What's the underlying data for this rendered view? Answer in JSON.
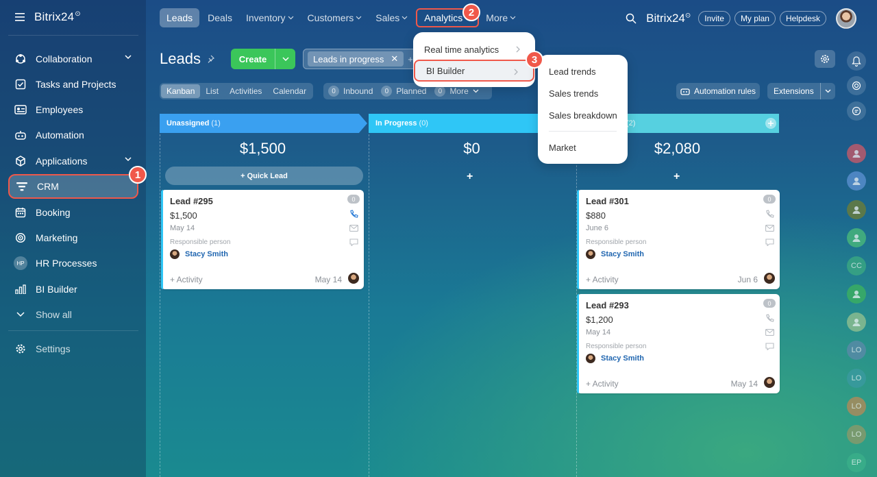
{
  "app": {
    "logo": "Bitrix24",
    "logo_mark": "⊙"
  },
  "sidebar": {
    "items": [
      {
        "label": "Collaboration",
        "icon": "collaboration-icon",
        "expand": true
      },
      {
        "label": "Tasks and Projects",
        "icon": "tasks-icon"
      },
      {
        "label": "Employees",
        "icon": "employees-icon"
      },
      {
        "label": "Automation",
        "icon": "automation-icon"
      },
      {
        "label": "Applications",
        "icon": "applications-icon",
        "expand": true
      },
      {
        "label": "CRM",
        "icon": "crm-icon",
        "active": true
      },
      {
        "label": "Booking",
        "icon": "booking-icon"
      },
      {
        "label": "Marketing",
        "icon": "marketing-icon"
      },
      {
        "label": "HR Processes",
        "icon": "hr-icon",
        "badge": "HP"
      },
      {
        "label": "BI Builder",
        "icon": "bi-builder-icon"
      },
      {
        "label": "Show all",
        "icon": "chevron-down-icon"
      }
    ],
    "settings": "Settings"
  },
  "topnav": [
    {
      "label": "Leads",
      "active": true
    },
    {
      "label": "Deals"
    },
    {
      "label": "Inventory",
      "dropdown": true
    },
    {
      "label": "Customers",
      "dropdown": true
    },
    {
      "label": "Sales",
      "dropdown": true
    },
    {
      "label": "Analytics",
      "dropdown": true,
      "highlight": true
    },
    {
      "label": "More",
      "dropdown": true
    }
  ],
  "header_right": {
    "logo": "Bitrix24",
    "invite": "Invite",
    "my_plan": "My plan",
    "helpdesk": "Helpdesk"
  },
  "page": {
    "title": "Leads",
    "create": "Create",
    "filter_chip": "Leads in progress",
    "filter_plus": "+"
  },
  "views": [
    "Kanban",
    "List",
    "Activities",
    "Calendar"
  ],
  "counters": [
    {
      "n": "0",
      "label": "Inbound"
    },
    {
      "n": "0",
      "label": "Planned"
    },
    {
      "n": "0",
      "label": "More"
    }
  ],
  "automation_rules": "Automation rules",
  "extensions": "Extensions",
  "columns": [
    {
      "name": "Unassigned",
      "count": "(1)",
      "sum": "$1,500",
      "color": "#3aa0f0",
      "quick_lead": "+ Quick Lead"
    },
    {
      "name": "In Progress",
      "count": "(0)",
      "sum": "$0",
      "color": "#2fc6f6"
    },
    {
      "name": "",
      "count": "(2)",
      "sum": "$2,080",
      "color": "#56d0e0"
    }
  ],
  "cards": [
    {
      "title": "Lead #295",
      "amount": "$1,500",
      "date": "May 14",
      "resp_label": "Responsible person",
      "person": "Stacy Smith",
      "activity": "+ Activity",
      "act_date": "May 14",
      "badge": "0",
      "phone_active": true
    },
    {
      "title": "Lead #301",
      "amount": "$880",
      "date": "June 6",
      "resp_label": "Responsible person",
      "person": "Stacy Smith",
      "activity": "+ Activity",
      "act_date": "Jun 6",
      "badge": "0"
    },
    {
      "title": "Lead #293",
      "amount": "$1,200",
      "date": "May 14",
      "resp_label": "Responsible person",
      "person": "Stacy Smith",
      "activity": "+ Activity",
      "act_date": "May 14",
      "badge": "0"
    }
  ],
  "analytics_menu": {
    "items": [
      "Real time analytics",
      "BI Builder"
    ]
  },
  "bi_submenu": {
    "items": [
      "Lead trends",
      "Sales trends",
      "Sales breakdown",
      "Market"
    ]
  },
  "callouts": [
    "1",
    "2",
    "3"
  ],
  "right_rail": [
    {
      "icon": "bell-icon"
    },
    {
      "icon": "copilot-icon"
    },
    {
      "icon": "chat-icon"
    },
    {
      "icon": "group-avatar-icon",
      "color": "#c45a6a"
    },
    {
      "icon": "group-avatar-icon",
      "color": "#5a8fcf"
    },
    {
      "icon": "user-avatar-icon",
      "color": "#6b7d3a"
    },
    {
      "icon": "chat-bubble-icon",
      "color": "#49b87a"
    },
    {
      "text": "CC",
      "color": "#3aa882"
    },
    {
      "icon": "notes-icon",
      "color": "#3bb060"
    },
    {
      "icon": "chart-icon",
      "color": "#8fbf90"
    },
    {
      "text": "LO",
      "color": "#5a8aa8"
    },
    {
      "text": "LO",
      "color": "#3a9aa0"
    },
    {
      "text": "LO",
      "color": "#b08a5a"
    },
    {
      "text": "LO",
      "color": "#8a9a6a"
    },
    {
      "text": "EP",
      "color": "#3ab08a"
    }
  ]
}
